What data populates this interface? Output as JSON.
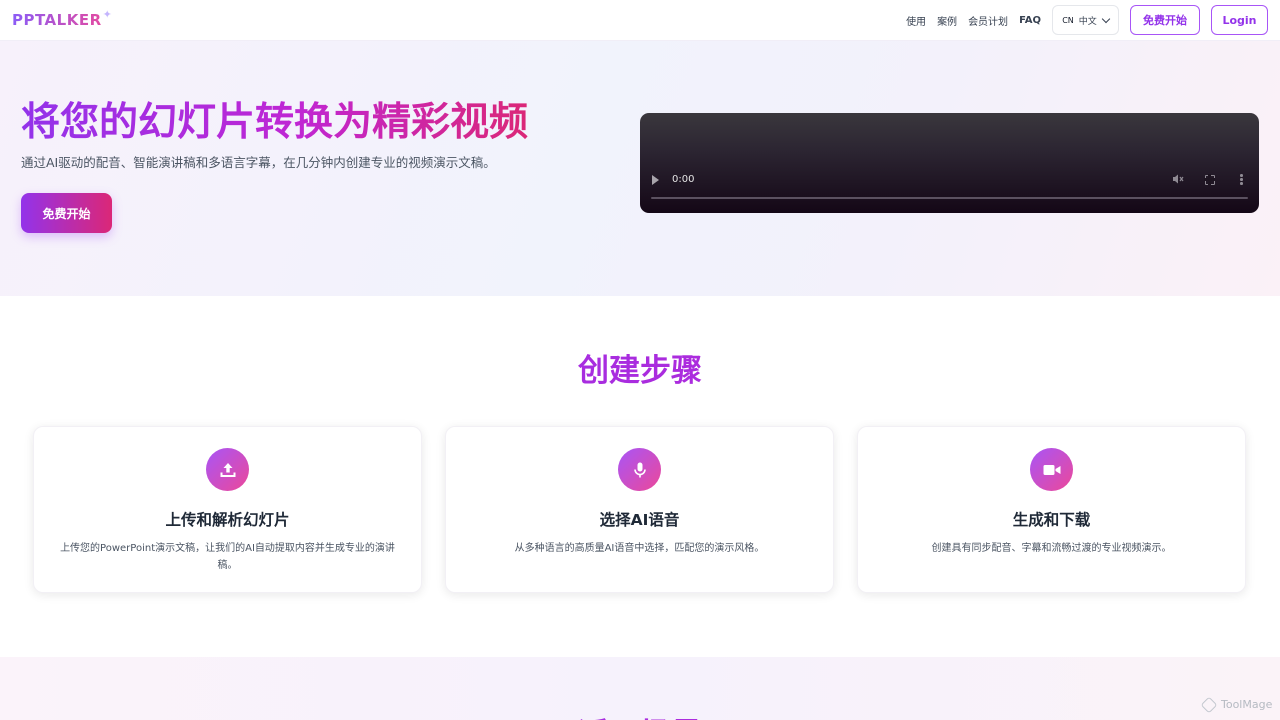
{
  "header": {
    "logo": "PPTALKER",
    "nav": [
      "使用",
      "案例",
      "会员计划",
      "FAQ"
    ],
    "lang_code": "CN",
    "lang_label": "中文",
    "free_start": "免费开始",
    "login": "Login"
  },
  "hero": {
    "title": "将您的幻灯片转换为精彩视频",
    "subtitle": "通过AI驱动的配音、智能演讲稿和多语言字幕，在几分钟内创建专业的视频演示文稿。",
    "cta": "免费开始",
    "video_time": "0:00"
  },
  "steps": {
    "title": "创建步骤",
    "cards": [
      {
        "title": "上传和解析幻灯片",
        "desc": "上传您的PowerPoint演示文稿，让我们的AI自动提取内容并生成专业的演讲稿。",
        "icon": "upload-icon"
      },
      {
        "title": "选择AI语音",
        "desc": "从多种语言的高质量AI语音中选择，匹配您的演示风格。",
        "icon": "microphone-icon"
      },
      {
        "title": "生成和下载",
        "desc": "创建具有同步配音、字幕和流畅过渡的专业视频演示。",
        "icon": "video-camera-icon"
      }
    ]
  },
  "next_section": {
    "title": "适用场景"
  },
  "watermark": "ToolMage",
  "colors": {
    "accent_purple": "#9333ea",
    "accent_pink": "#db2777"
  }
}
